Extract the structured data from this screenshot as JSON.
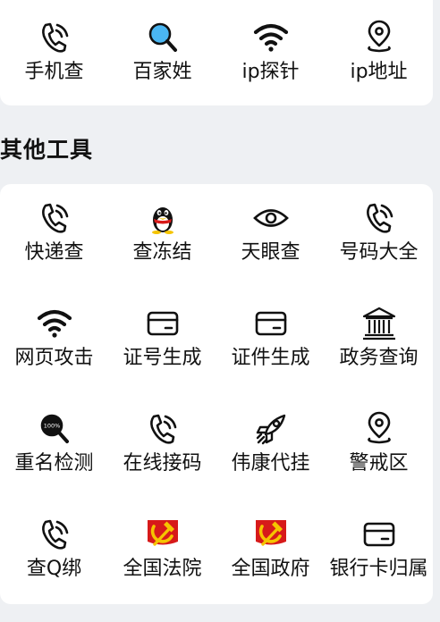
{
  "top_tools": [
    {
      "label": "手机查",
      "icon": "phone-icon"
    },
    {
      "label": "百家姓",
      "icon": "magnifier-icon"
    },
    {
      "label": "ip探针",
      "icon": "wifi-icon"
    },
    {
      "label": "ip地址",
      "icon": "location-pin-icon"
    }
  ],
  "section": {
    "title": "其他工具"
  },
  "other_tools": [
    {
      "label": "快递查",
      "icon": "phone-icon"
    },
    {
      "label": "查冻结",
      "icon": "penguin-icon"
    },
    {
      "label": "天眼查",
      "icon": "eye-icon"
    },
    {
      "label": "号码大全",
      "icon": "phone-icon"
    },
    {
      "label": "网页攻击",
      "icon": "wifi-icon"
    },
    {
      "label": "证号生成",
      "icon": "card-icon"
    },
    {
      "label": "证件生成",
      "icon": "card-icon"
    },
    {
      "label": "政务查询",
      "icon": "government-building-icon"
    },
    {
      "label": "重名检测",
      "icon": "magnifier-icon",
      "icon_text": "100%"
    },
    {
      "label": "在线接码",
      "icon": "phone-icon"
    },
    {
      "label": "伟康代挂",
      "icon": "rocket-icon"
    },
    {
      "label": "警戒区",
      "icon": "location-pin-icon"
    },
    {
      "label": "查Q绑",
      "icon": "phone-icon"
    },
    {
      "label": "全国法院",
      "icon": "hammer-sickle-icon"
    },
    {
      "label": "全国政府",
      "icon": "hammer-sickle-icon"
    },
    {
      "label": "银行卡归属",
      "icon": "card-icon"
    }
  ],
  "colors": {
    "background": "#eef0f3",
    "card": "#ffffff",
    "text": "#111111",
    "accent_blue": "#4ab6f2",
    "emblem_red": "#d71a1a",
    "emblem_gold": "#f5c400"
  }
}
